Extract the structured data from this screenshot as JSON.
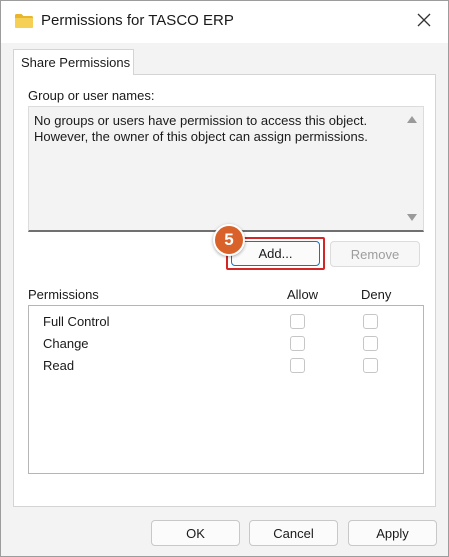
{
  "window": {
    "title": "Permissions for TASCO ERP"
  },
  "tabs": [
    {
      "label": "Share Permissions"
    }
  ],
  "group": {
    "label": "Group or user names:",
    "message": "No groups or users have permission to access this object. However, the owner of this object can assign permissions."
  },
  "buttons": {
    "add": "Add...",
    "remove": "Remove",
    "ok": "OK",
    "cancel": "Cancel",
    "apply": "Apply"
  },
  "step_badge": "5",
  "permissions": {
    "header": "Permissions",
    "allow_header": "Allow",
    "deny_header": "Deny",
    "rows": [
      {
        "name": "Full Control",
        "allow": false,
        "deny": false
      },
      {
        "name": "Change",
        "allow": false,
        "deny": false
      },
      {
        "name": "Read",
        "allow": false,
        "deny": false
      }
    ]
  },
  "colors": {
    "highlight": "#d32626",
    "badge": "#d9622a",
    "focus": "#1d6fc1"
  },
  "icons": {
    "title": "folder-icon",
    "close": "close-icon"
  }
}
